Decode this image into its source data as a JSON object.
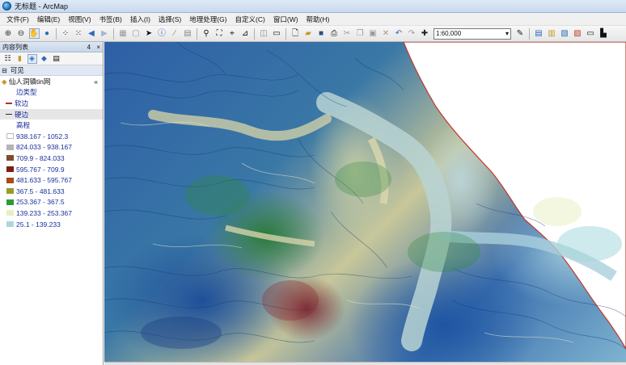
{
  "window": {
    "title": "无标题 - ArcMap"
  },
  "menu": [
    "文件(F)",
    "编辑(E)",
    "视图(V)",
    "书签(B)",
    "插入(I)",
    "选择(S)",
    "地理处理(G)",
    "自定义(C)",
    "窗口(W)",
    "帮助(H)"
  ],
  "toolbar": {
    "scale": "1:60,000"
  },
  "toc": {
    "title": "内容列表",
    "pin": "4",
    "close": "×",
    "section": "可见",
    "layer": "仙人洞镇tin网",
    "edge_type_label": "边类型",
    "soft_edge": "软边",
    "hard_edge": "硬边",
    "elevation_label": "高程",
    "classes": [
      {
        "label": "938.167 - 1052.3",
        "color": "#ffffff"
      },
      {
        "label": "824.033 - 938.167",
        "color": "#b4b4b4"
      },
      {
        "label": "709.9 - 824.033",
        "color": "#7a4e2e"
      },
      {
        "label": "595.767 - 709.9",
        "color": "#7a1f12"
      },
      {
        "label": "481.633 - 595.767",
        "color": "#a84a1a"
      },
      {
        "label": "367.5 - 481.633",
        "color": "#9a9a2a"
      },
      {
        "label": "253.367 - 367.5",
        "color": "#2e9a3a"
      },
      {
        "label": "139.233 - 253.367",
        "color": "#e9efc0"
      },
      {
        "label": "25.1 - 139.233",
        "color": "#a8d8dc"
      }
    ],
    "colors": {
      "soft_edge": "#b03030",
      "hard_edge": "#2a2a2a"
    }
  }
}
